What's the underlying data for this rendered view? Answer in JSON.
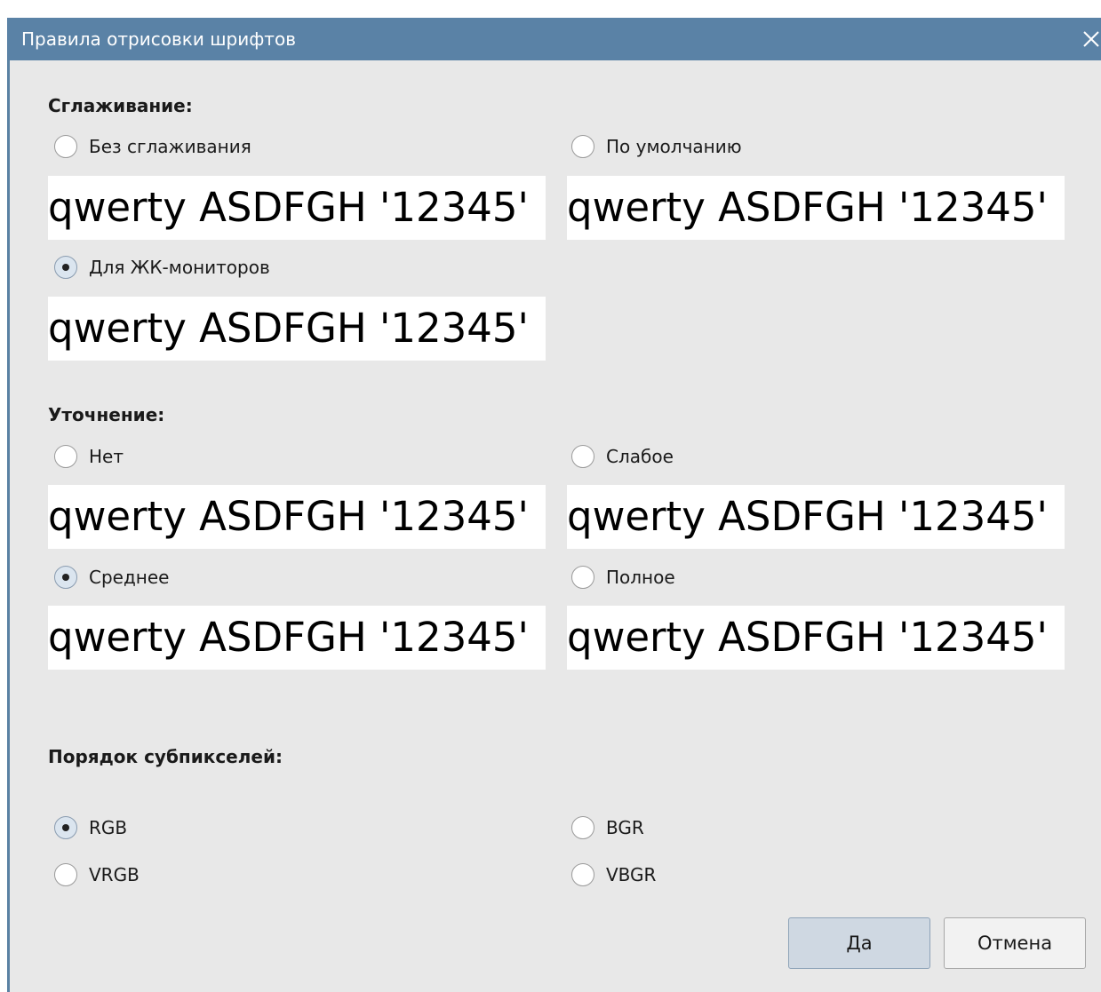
{
  "window": {
    "title": "Правила отрисовки шрифтов",
    "close_icon": "close-icon"
  },
  "antialiasing": {
    "title": "Сглаживание:",
    "options": [
      {
        "label": "Без сглаживания",
        "checked": false,
        "sample": "qwerty ASDFGH '12345'"
      },
      {
        "label": "По умолчанию",
        "checked": false,
        "sample": "qwerty ASDFGH '12345'"
      },
      {
        "label": "Для ЖК-мониторов",
        "checked": true,
        "sample": "qwerty ASDFGH '12345'"
      }
    ]
  },
  "hinting": {
    "title": "Уточнение:",
    "options": [
      {
        "label": "Нет",
        "checked": false,
        "sample": "qwerty ASDFGH '12345'"
      },
      {
        "label": "Слабое",
        "checked": false,
        "sample": "qwerty ASDFGH '12345'"
      },
      {
        "label": "Среднее",
        "checked": true,
        "sample": "qwerty ASDFGH '12345'"
      },
      {
        "label": "Полное",
        "checked": false,
        "sample": "qwerty ASDFGH '12345'"
      }
    ]
  },
  "subpixel": {
    "title": "Порядок субпикселей:",
    "options": [
      {
        "label": "RGB",
        "checked": true
      },
      {
        "label": "BGR",
        "checked": false
      },
      {
        "label": "VRGB",
        "checked": false
      },
      {
        "label": "VBGR",
        "checked": false
      }
    ]
  },
  "buttons": {
    "ok": "Да",
    "cancel": "Отмена"
  },
  "colors": {
    "titlebar": "#5a82a6",
    "background": "#e8e8e8",
    "sample_background": "#ffffff",
    "ok_button": "#cfd8e2"
  }
}
